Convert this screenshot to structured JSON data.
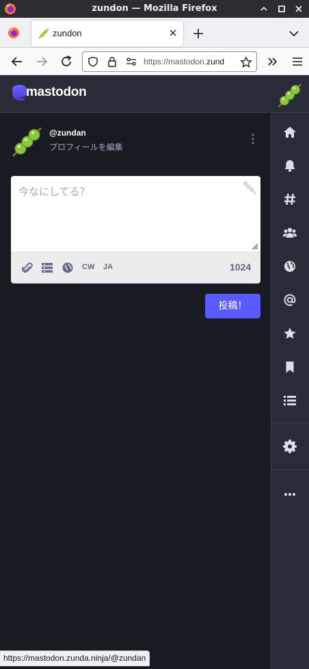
{
  "window": {
    "title": "zundon — Mozilla Firefox"
  },
  "browser": {
    "tab_label": "zundon",
    "url_prefix": "https://mastodon.",
    "url_host_tail": "zund",
    "status_url": "https://mastodon.zunda.ninja/@zundan"
  },
  "header": {
    "logo_text": "mastodon"
  },
  "account": {
    "handle": "@zundan",
    "edit_profile": "プロフィールを編集"
  },
  "compose": {
    "placeholder": "今なにしてる？",
    "cw_label": "CW",
    "lang_label": "JA",
    "char_count": "1024",
    "submit_label": "投稿！"
  },
  "sidebar": {
    "items": [
      "home-icon",
      "bell-icon",
      "hashtag-icon",
      "users-icon",
      "globe-icon",
      "at-icon",
      "star-icon",
      "bookmark-icon",
      "list-icon",
      "gear-icon",
      "more-icon"
    ]
  },
  "colors": {
    "accent": "#595aff",
    "panel": "#282c37",
    "background": "#191b22",
    "muted_text": "#9baec8",
    "toolbar_icon": "#606984"
  }
}
